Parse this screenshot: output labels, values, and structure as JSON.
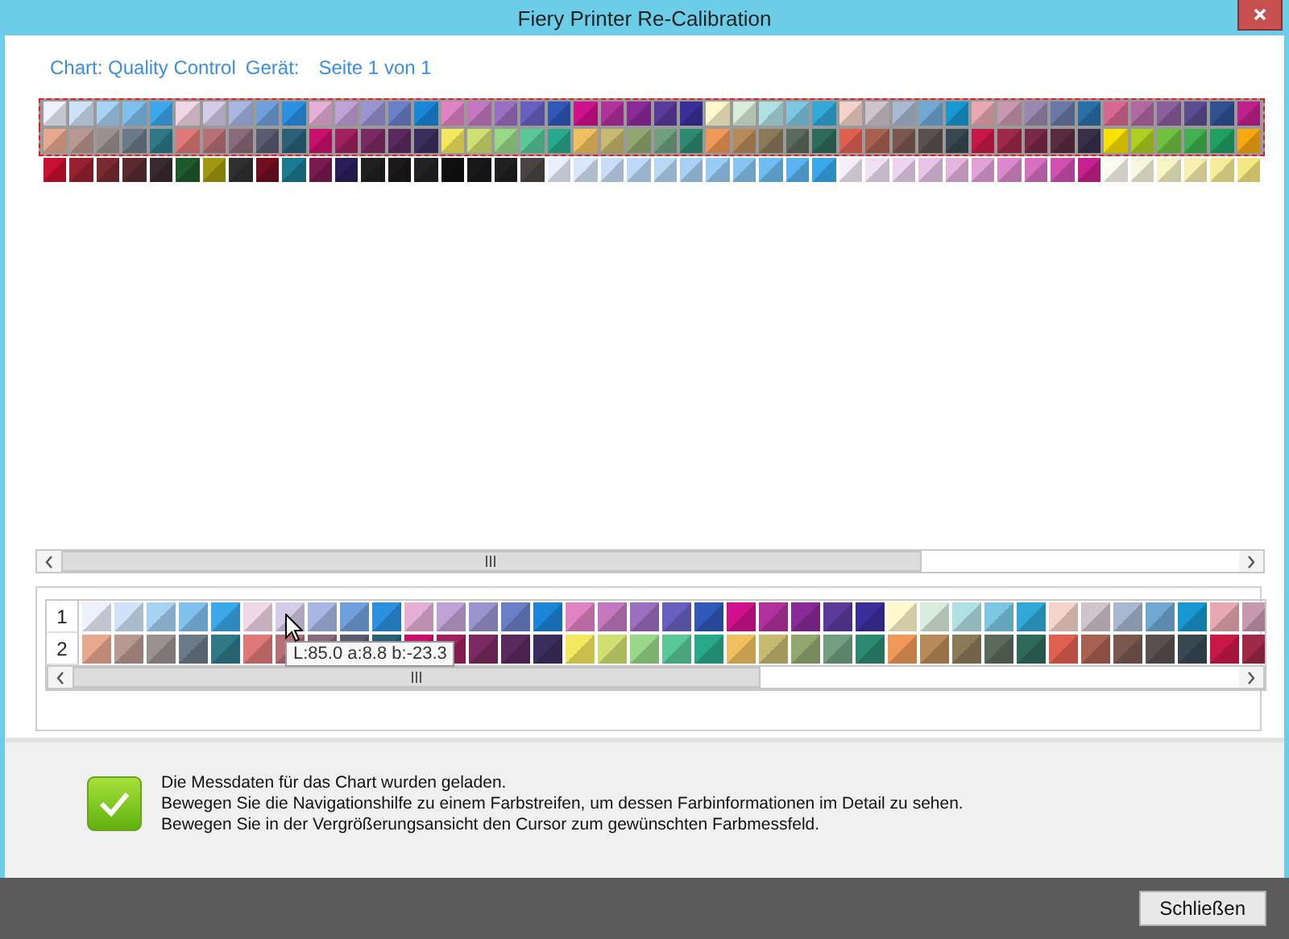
{
  "window": {
    "title": "Fiery Printer Re-Calibration"
  },
  "header": {
    "chart": "Chart: Quality Control",
    "device": "Gerät:",
    "page": "Seite 1 von 1"
  },
  "chart_overview": {
    "rows": [
      {
        "selected": true,
        "patches": [
          {
            "color": "#eef0fc"
          },
          {
            "color": "#cfe3f8"
          },
          {
            "color": "#a6d2f4"
          },
          {
            "color": "#7ec0ee"
          },
          {
            "color": "#3aa8ea"
          },
          {
            "color": "#f1d6e6"
          },
          {
            "color": "#d3cbe8"
          },
          {
            "color": "#a9b6e4"
          },
          {
            "color": "#6fa0dc"
          },
          {
            "color": "#2b90e0"
          },
          {
            "color": "#e6b0d6"
          },
          {
            "color": "#c1a2d6"
          },
          {
            "color": "#9b92d0"
          },
          {
            "color": "#6a7fc8"
          },
          {
            "color": "#1a86d8"
          },
          {
            "color": "#e082c4"
          },
          {
            "color": "#c377be"
          },
          {
            "color": "#9a6ec0"
          },
          {
            "color": "#6860c0"
          },
          {
            "color": "#3058b8"
          },
          {
            "color": "#d0108c"
          },
          {
            "color": "#b0309c"
          },
          {
            "color": "#8a2a98"
          },
          {
            "color": "#5a3a9a"
          },
          {
            "color": "#3a2e9a"
          },
          {
            "color": "#fff8cc"
          },
          {
            "color": "#d8ecdc"
          },
          {
            "color": "#b0e0e4"
          },
          {
            "color": "#7cc8e4"
          },
          {
            "color": "#30a8d8"
          },
          {
            "color": "#f4d4c8"
          },
          {
            "color": "#d0c4cc"
          },
          {
            "color": "#a8b8d0"
          },
          {
            "color": "#70a8d4"
          },
          {
            "color": "#1898d0"
          },
          {
            "color": "#e8a8b0"
          },
          {
            "color": "#c898b0"
          },
          {
            "color": "#9a88b0"
          },
          {
            "color": "#6a78a8"
          },
          {
            "color": "#2870a8"
          },
          {
            "color": "#d86890"
          },
          {
            "color": "#b068a0"
          },
          {
            "color": "#8a5e9a"
          },
          {
            "color": "#5a4e90"
          },
          {
            "color": "#305090"
          },
          {
            "color": "#c0208c"
          }
        ]
      },
      {
        "selected": true,
        "patches": [
          {
            "color": "#e8a890"
          },
          {
            "color": "#b89890"
          },
          {
            "color": "#9a9090"
          },
          {
            "color": "#6a7a88"
          },
          {
            "color": "#2e7888"
          },
          {
            "color": "#e07878"
          },
          {
            "color": "#b87078"
          },
          {
            "color": "#8a6a7a"
          },
          {
            "color": "#5a5a70"
          },
          {
            "color": "#2a6078"
          },
          {
            "color": "#c8106a"
          },
          {
            "color": "#a02060"
          },
          {
            "color": "#7a2a60"
          },
          {
            "color": "#5a2a5e"
          },
          {
            "color": "#3a2e5e"
          },
          {
            "color": "#f4e860"
          },
          {
            "color": "#d0e070"
          },
          {
            "color": "#98d888"
          },
          {
            "color": "#58c898"
          },
          {
            "color": "#28a88a"
          },
          {
            "color": "#f0c060"
          },
          {
            "color": "#c8b870"
          },
          {
            "color": "#90a870"
          },
          {
            "color": "#70a080"
          },
          {
            "color": "#2c8a70"
          },
          {
            "color": "#f09858"
          },
          {
            "color": "#b88a58"
          },
          {
            "color": "#8a7a58"
          },
          {
            "color": "#5a6a5a"
          },
          {
            "color": "#2e6a5a"
          },
          {
            "color": "#e06050"
          },
          {
            "color": "#a86050"
          },
          {
            "color": "#7a5850"
          },
          {
            "color": "#5a5050"
          },
          {
            "color": "#384850"
          },
          {
            "color": "#c81848"
          },
          {
            "color": "#a02848"
          },
          {
            "color": "#7a2848"
          },
          {
            "color": "#5a2a40"
          },
          {
            "color": "#38304a"
          },
          {
            "color": "#f8e000"
          },
          {
            "color": "#b0d020"
          },
          {
            "color": "#70c040"
          },
          {
            "color": "#40b050"
          },
          {
            "color": "#20a060"
          },
          {
            "color": "#f8a810"
          }
        ]
      },
      {
        "selected": false,
        "patches": [
          {
            "color": "#c81030"
          },
          {
            "color": "#982030"
          },
          {
            "color": "#782a30"
          },
          {
            "color": "#5a2a30"
          },
          {
            "color": "#3a2a30"
          },
          {
            "color": "#1e5a2a"
          },
          {
            "color": "#a09a10"
          },
          {
            "color": "#303030"
          },
          {
            "color": "#700e20"
          },
          {
            "color": "#1a7a90"
          },
          {
            "color": "#7a1a50"
          },
          {
            "color": "#2a1e5a"
          },
          {
            "color": "#202020"
          },
          {
            "color": "#1a1a1a"
          },
          {
            "color": "#222222"
          },
          {
            "color": "#101010"
          },
          {
            "color": "#181818"
          },
          {
            "color": "#202020"
          },
          {
            "color": "#4a4444"
          },
          {
            "color": "#e8eefc"
          },
          {
            "color": "#d8e6fa"
          },
          {
            "color": "#c8def8"
          },
          {
            "color": "#bcdaf8"
          },
          {
            "color": "#b8d8f6"
          },
          {
            "color": "#a8d0f4"
          },
          {
            "color": "#98ccf4"
          },
          {
            "color": "#88c4f2"
          },
          {
            "color": "#70bcf2"
          },
          {
            "color": "#58b4f0"
          },
          {
            "color": "#3aa8ec"
          },
          {
            "color": "#f4eef8"
          },
          {
            "color": "#f0e0f4"
          },
          {
            "color": "#ecd4f0"
          },
          {
            "color": "#e8c4e8"
          },
          {
            "color": "#e4b4e0"
          },
          {
            "color": "#e0a0d8"
          },
          {
            "color": "#dc88cc"
          },
          {
            "color": "#d870c0"
          },
          {
            "color": "#d050b0"
          },
          {
            "color": "#c8208e"
          },
          {
            "color": "#fcfcf0"
          },
          {
            "color": "#f8f8e0"
          },
          {
            "color": "#f8f4c8"
          },
          {
            "color": "#f8f0b0"
          },
          {
            "color": "#f8ec98"
          },
          {
            "color": "#f4e880"
          }
        ]
      }
    ]
  },
  "zoom_strip": {
    "rows": [
      {
        "label": "1",
        "patches": [
          {
            "color": "#eef0fc"
          },
          {
            "color": "#cfe3f8"
          },
          {
            "color": "#a6d2f4"
          },
          {
            "color": "#7ec0ee"
          },
          {
            "color": "#3aa8ea"
          },
          {
            "color": "#f1d6e6"
          },
          {
            "color": "#d3cbe8"
          },
          {
            "color": "#a9b6e4"
          },
          {
            "color": "#6fa0dc"
          },
          {
            "color": "#2b90e0"
          },
          {
            "color": "#e6b0d6"
          },
          {
            "color": "#c1a2d6"
          },
          {
            "color": "#9b92d0"
          },
          {
            "color": "#6a7fc8"
          },
          {
            "color": "#1a86d8"
          },
          {
            "color": "#e082c4"
          },
          {
            "color": "#c377be"
          },
          {
            "color": "#9a6ec0"
          },
          {
            "color": "#6860c0"
          },
          {
            "color": "#3058b8"
          },
          {
            "color": "#d0108c"
          },
          {
            "color": "#b0309c"
          },
          {
            "color": "#8a2a98"
          },
          {
            "color": "#5a3a9a"
          },
          {
            "color": "#3a2e9a"
          },
          {
            "color": "#fff8cc"
          },
          {
            "color": "#d8ecdc"
          },
          {
            "color": "#b0e0e4"
          },
          {
            "color": "#7cc8e4"
          },
          {
            "color": "#30a8d8"
          },
          {
            "color": "#f4d4c8"
          },
          {
            "color": "#d0c4cc"
          },
          {
            "color": "#a8b8d0"
          },
          {
            "color": "#70a8d4"
          },
          {
            "color": "#1898d0"
          },
          {
            "color": "#e8a8b0"
          },
          {
            "color": "#c898b0"
          }
        ]
      },
      {
        "label": "2",
        "patches": [
          {
            "color": "#e8a890"
          },
          {
            "color": "#b89890"
          },
          {
            "color": "#9a9090"
          },
          {
            "color": "#6a7a88"
          },
          {
            "color": "#2e7888"
          },
          {
            "color": "#e07878"
          },
          {
            "color": "#b87078"
          },
          {
            "color": "#8a6a7a"
          },
          {
            "color": "#5a5a70"
          },
          {
            "color": "#2a6078"
          },
          {
            "color": "#c8106a"
          },
          {
            "color": "#a02060"
          },
          {
            "color": "#7a2a60"
          },
          {
            "color": "#5a2a5e"
          },
          {
            "color": "#3a2e5e"
          },
          {
            "color": "#f4e860"
          },
          {
            "color": "#d0e070"
          },
          {
            "color": "#98d888"
          },
          {
            "color": "#58c898"
          },
          {
            "color": "#28a88a"
          },
          {
            "color": "#f0c060"
          },
          {
            "color": "#c8b870"
          },
          {
            "color": "#90a870"
          },
          {
            "color": "#70a080"
          },
          {
            "color": "#2c8a70"
          },
          {
            "color": "#f09858"
          },
          {
            "color": "#b88a58"
          },
          {
            "color": "#8a7a58"
          },
          {
            "color": "#5a6a5a"
          },
          {
            "color": "#2e6a5a"
          },
          {
            "color": "#e06050"
          },
          {
            "color": "#a86050"
          },
          {
            "color": "#7a5850"
          },
          {
            "color": "#5a5050"
          },
          {
            "color": "#384850"
          },
          {
            "color": "#c81848"
          },
          {
            "color": "#a02848"
          }
        ]
      }
    ],
    "tooltip": "L:85.0 a:8.8 b:-23.3"
  },
  "message": {
    "kind": "success",
    "lines": [
      "Die Messdaten für das Chart wurden geladen.",
      "Bewegen Sie die Navigationshilfe zu einem Farbstreifen, um dessen Farbinformationen im Detail zu sehen.",
      "Bewegen Sie in der Vergrößerungsansicht den Cursor zum gewünschten Farbmessfeld."
    ]
  },
  "buttons": [
    {
      "label": "Schließen"
    }
  ]
}
